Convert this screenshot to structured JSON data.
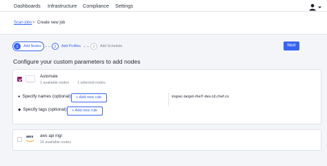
{
  "nav": {
    "items": [
      "Dashboards",
      "Infrastructure",
      "Compliance",
      "Settings"
    ],
    "user_icon": "user-icon"
  },
  "breadcrumb": {
    "parent": "Scan jobs",
    "separator": ">",
    "current": "Create new job"
  },
  "stepper": {
    "steps": [
      {
        "number": "1",
        "label": "Add Nodes",
        "state": "active"
      },
      {
        "number": "2",
        "label": "Add Profiles",
        "state": "pending"
      },
      {
        "number": "3",
        "label": "Add Schedule",
        "state": "future"
      }
    ],
    "next_label": "Next"
  },
  "section_title": "Configure your custom parameters to add nodes",
  "managers": [
    {
      "name": "Automate",
      "available": "1 available nodes",
      "dot": "·",
      "selected": "1 selected nodes",
      "checked": true,
      "names_label": "Specify names (optional)",
      "tags_label": "Specify tags (optional)",
      "add_rule_label": "Add new rule",
      "name_result": "inspec-target-rhel7-dev.cd.chef.co"
    },
    {
      "name": "aws api mgr",
      "logo_text": "aws",
      "available": "16 available nodes",
      "checked": false
    }
  ],
  "colors": {
    "accent": "#3864f2",
    "checkbox": "#8a1f6e",
    "background": "#f4f5f8"
  }
}
